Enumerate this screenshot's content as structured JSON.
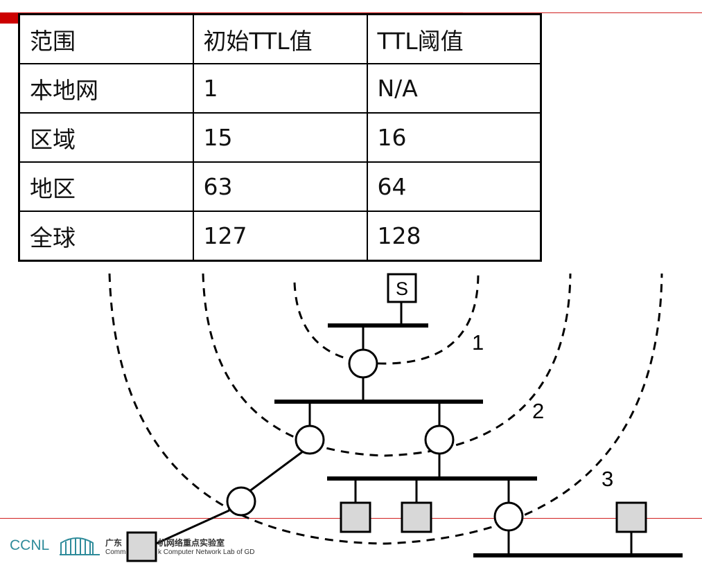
{
  "table": {
    "header": [
      "范围",
      "初始TTL值",
      "TTL阈值"
    ],
    "rows": [
      [
        "本地网",
        "1",
        "N/A"
      ],
      [
        "区域",
        "15",
        "16"
      ],
      [
        "地区",
        "63",
        "64"
      ],
      [
        "全球",
        "127",
        "128"
      ]
    ]
  },
  "diagram": {
    "source_label": "S",
    "ring_labels": [
      "1",
      "2",
      "3"
    ]
  },
  "logo": {
    "name": "CCNL",
    "chinese": "广东",
    "chinese_rest": "机网络重点实验室",
    "english_start": "Comm",
    "english_rest": "k Computer Network Lab of GD"
  },
  "colors": {
    "accent_red": "#cc0000",
    "host_fill": "#d8d8d8",
    "logo_teal": "#2e8b9a"
  }
}
